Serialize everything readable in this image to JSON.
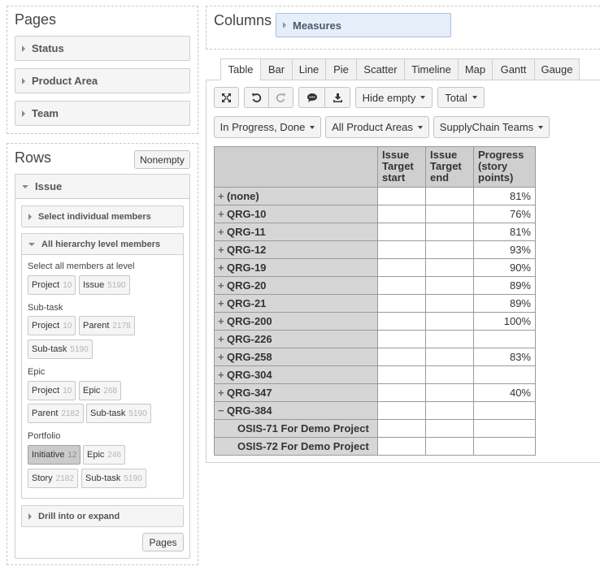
{
  "pages": {
    "title": "Pages",
    "items": [
      {
        "label": "Status"
      },
      {
        "label": "Product Area"
      },
      {
        "label": "Team"
      }
    ]
  },
  "rows": {
    "title": "Rows",
    "nonempty_label": "Nonempty",
    "issue_label": "Issue",
    "select_individual": "Select individual members",
    "all_hierarchy": "All hierarchy level members",
    "select_all_text": "Select all members at level",
    "groups": {
      "issue_group": {
        "chips": [
          {
            "label": "Project",
            "count": "10"
          },
          {
            "label": "Issue",
            "count": "5190"
          }
        ]
      },
      "subtask": {
        "label": "Sub-task",
        "chips": [
          {
            "label": "Project",
            "count": "10"
          },
          {
            "label": "Parent",
            "count": "2178"
          },
          {
            "label": "Sub-task",
            "count": "5190"
          }
        ]
      },
      "epic": {
        "label": "Epic",
        "chips": [
          {
            "label": "Project",
            "count": "10"
          },
          {
            "label": "Epic",
            "count": "268"
          },
          {
            "label": "Parent",
            "count": "2182"
          },
          {
            "label": "Sub-task",
            "count": "5190"
          }
        ]
      },
      "portfolio": {
        "label": "Portfolio",
        "chips": [
          {
            "label": "Initiative",
            "count": "12"
          },
          {
            "label": "Epic",
            "count": "246"
          },
          {
            "label": "Story",
            "count": "2182"
          },
          {
            "label": "Sub-task",
            "count": "5190"
          }
        ]
      }
    },
    "drill_label": "Drill into or expand",
    "pages_button": "Pages"
  },
  "columns": {
    "title": "Columns",
    "measures_label": "Measures"
  },
  "tabs": [
    "Table",
    "Bar",
    "Line",
    "Pie",
    "Scatter",
    "Timeline",
    "Map",
    "Gantt",
    "Gauge"
  ],
  "toolbar": {
    "hide_empty": "Hide empty",
    "total": "Total"
  },
  "filters": {
    "status": "In Progress, Done",
    "product_area": "All Product Areas",
    "team": "SupplyChain Teams"
  },
  "table": {
    "headers": [
      "Issue Target start",
      "Issue Target end",
      "Progress (story points)"
    ],
    "rows": [
      {
        "label": "(none)",
        "progress": "81%"
      },
      {
        "label": "QRG-10",
        "progress": "76%"
      },
      {
        "label": "QRG-11",
        "progress": "81%"
      },
      {
        "label": "QRG-12",
        "progress": "93%"
      },
      {
        "label": "QRG-19",
        "progress": "90%"
      },
      {
        "label": "QRG-20",
        "progress": "89%"
      },
      {
        "label": "QRG-21",
        "progress": "89%"
      },
      {
        "label": "QRG-200",
        "progress": "100%"
      },
      {
        "label": "QRG-226",
        "progress": ""
      },
      {
        "label": "QRG-258",
        "progress": "83%"
      },
      {
        "label": "QRG-304",
        "progress": ""
      },
      {
        "label": "QRG-347",
        "progress": "40%"
      },
      {
        "label": "QRG-384",
        "progress": ""
      }
    ],
    "child_rows": [
      {
        "label": "OSIS-71 For Demo Project"
      },
      {
        "label": "OSIS-72 For Demo Project"
      }
    ]
  },
  "icons": {
    "expand": "expand-icon",
    "undo": "undo-icon",
    "redo": "redo-icon",
    "comment": "comment-icon",
    "download": "download-icon"
  }
}
